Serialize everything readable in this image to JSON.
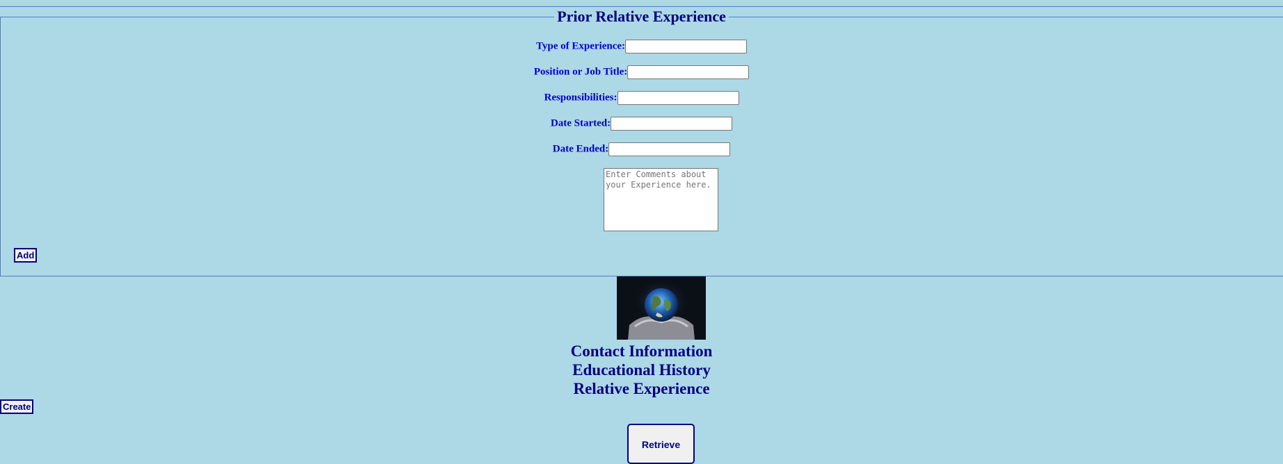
{
  "experience_section": {
    "legend": "Prior Relative Experience",
    "fields": [
      {
        "label": "Type of Experience:",
        "value": ""
      },
      {
        "label": "Position or Job Title:",
        "value": ""
      },
      {
        "label": "Responsibilities:",
        "value": ""
      },
      {
        "label": "Date Started:",
        "value": ""
      },
      {
        "label": "Date Ended:",
        "value": ""
      }
    ],
    "comments_placeholder": "Enter Comments about your Experience here.",
    "add_label": "Add"
  },
  "nav": {
    "contact": "Contact Information",
    "education": "Educational History",
    "experience": "Relative Experience"
  },
  "create_label": "Create",
  "retrieve_label": "Retrieve",
  "image": {
    "icon": "globe-in-hands-image"
  },
  "colors": {
    "background": "#add8e6",
    "heading": "#000080",
    "label": "#0000cd",
    "border": "#4f7fc6"
  }
}
